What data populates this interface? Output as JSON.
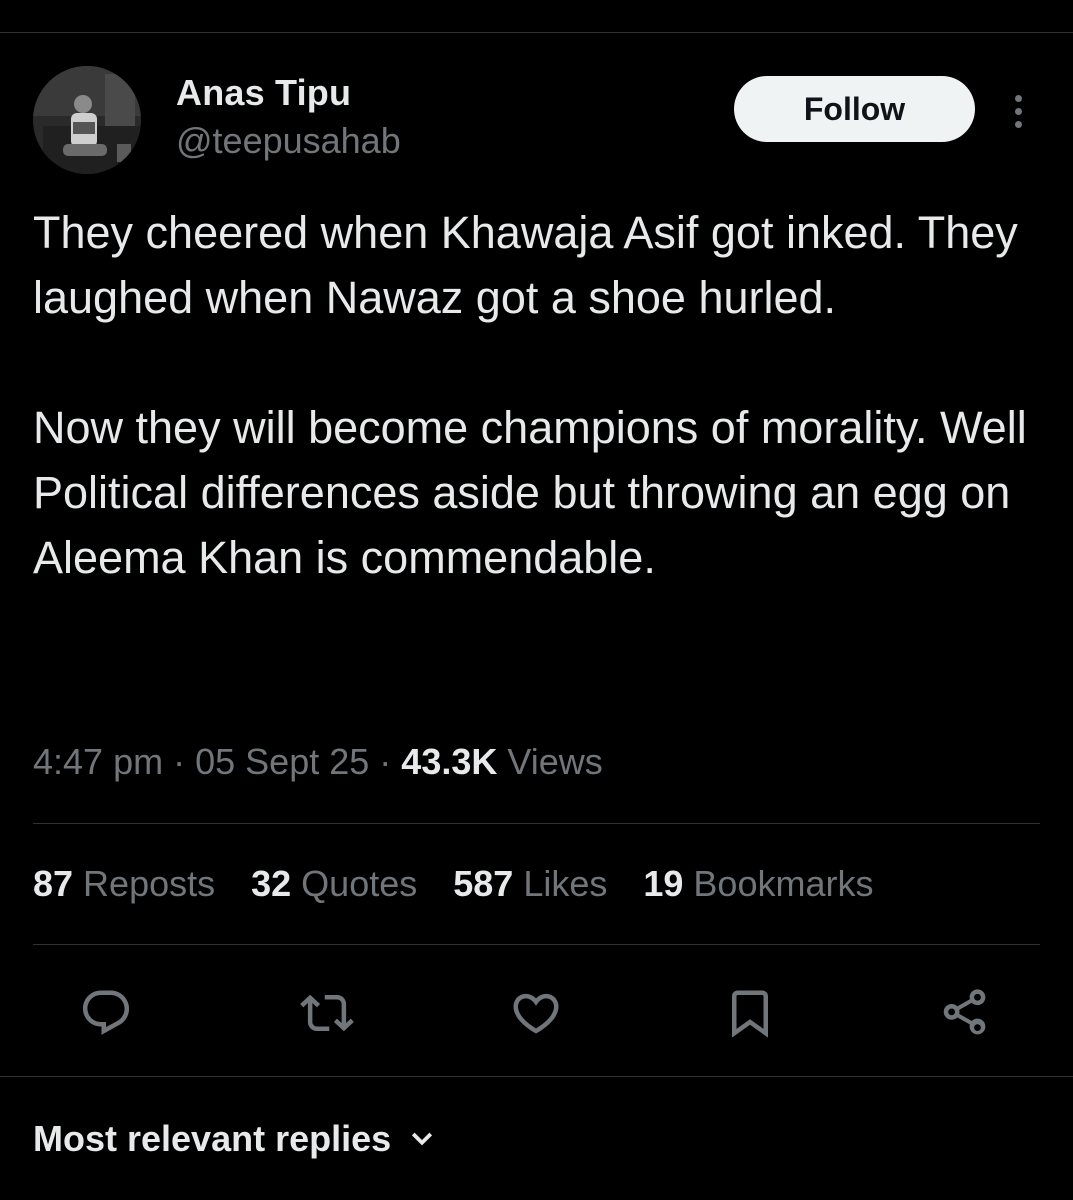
{
  "author": {
    "display_name": "Anas Tipu",
    "handle": "@teepusahab"
  },
  "follow_label": "Follow",
  "tweet": {
    "paragraphs": [
      "They cheered when Khawaja Asif got inked. They laughed when Nawaz got a shoe hurled.",
      "Now they will become champions of morality. Well Political differences aside but throwing an egg on Aleema Khan is commendable."
    ],
    "time": "4:47 pm",
    "date": "05 Sept 25",
    "views_count": "43.3K",
    "views_label": "Views",
    "separator": "·"
  },
  "stats": [
    {
      "num": "87",
      "label": "Reposts"
    },
    {
      "num": "32",
      "label": "Quotes"
    },
    {
      "num": "587",
      "label": "Likes"
    },
    {
      "num": "19",
      "label": "Bookmarks"
    }
  ],
  "actions": [
    {
      "icon": "reply-icon"
    },
    {
      "icon": "repost-icon"
    },
    {
      "icon": "like-icon"
    },
    {
      "icon": "bookmark-icon"
    },
    {
      "icon": "share-icon"
    }
  ],
  "replies_sort_label": "Most relevant replies",
  "colors": {
    "background": "#000000",
    "text_primary": "#e7e9ea",
    "text_secondary": "#71767b",
    "divider": "#2f3336",
    "follow_button_bg": "#eff3f4"
  }
}
